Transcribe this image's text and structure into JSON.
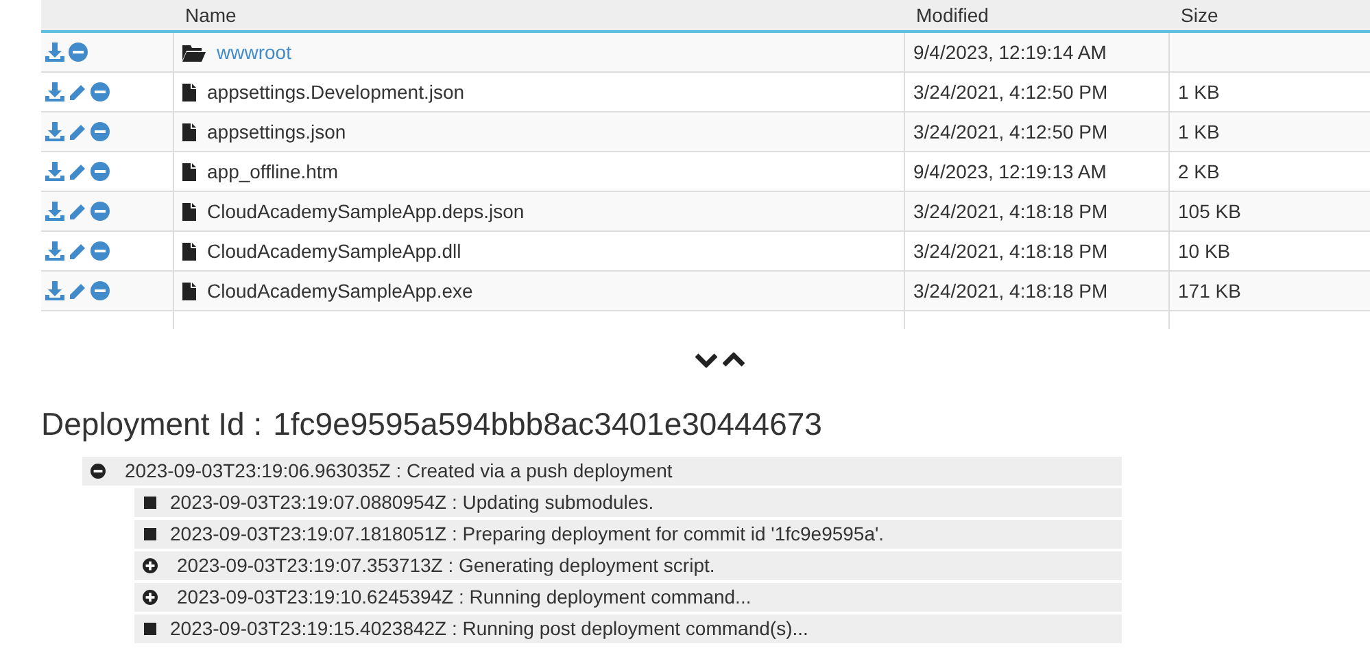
{
  "table": {
    "columns": [
      "Name",
      "Modified",
      "Size"
    ],
    "rows": [
      {
        "kind": "folder",
        "name": "wwwroot",
        "modified": "9/4/2023, 12:19:14 AM",
        "size": ""
      },
      {
        "kind": "file",
        "name": "appsettings.Development.json",
        "modified": "3/24/2021, 4:12:50 PM",
        "size": "1 KB"
      },
      {
        "kind": "file",
        "name": "appsettings.json",
        "modified": "3/24/2021, 4:12:50 PM",
        "size": "1 KB"
      },
      {
        "kind": "file",
        "name": "app_offline.htm",
        "modified": "9/4/2023, 12:19:13 AM",
        "size": "2 KB"
      },
      {
        "kind": "file",
        "name": "CloudAcademySampleApp.deps.json",
        "modified": "3/24/2021, 4:18:18 PM",
        "size": "105 KB"
      },
      {
        "kind": "file",
        "name": "CloudAcademySampleApp.dll",
        "modified": "3/24/2021, 4:18:18 PM",
        "size": "10 KB"
      },
      {
        "kind": "file",
        "name": "CloudAcademySampleApp.exe",
        "modified": "3/24/2021, 4:18:18 PM",
        "size": "171 KB"
      }
    ]
  },
  "deployment": {
    "label": "Deployment Id :",
    "id": "1fc9e9595a594bbb8ac3401e30444673"
  },
  "log": [
    {
      "kind": "expandable",
      "expanded": true,
      "text": "2023-09-03T23:19:06.963035Z : Created via a push deployment",
      "children": [
        {
          "kind": "leaf",
          "text": "2023-09-03T23:19:07.0880954Z : Updating submodules."
        },
        {
          "kind": "leaf",
          "text": "2023-09-03T23:19:07.1818051Z : Preparing deployment for commit id '1fc9e9595a'."
        },
        {
          "kind": "expandable",
          "expanded": false,
          "text": "2023-09-03T23:19:07.353713Z : Generating deployment script."
        },
        {
          "kind": "expandable",
          "expanded": false,
          "text": "2023-09-03T23:19:10.6245394Z : Running deployment command..."
        },
        {
          "kind": "leaf",
          "text": "2023-09-03T23:19:15.4023842Z : Running post deployment command(s)..."
        }
      ]
    }
  ]
}
